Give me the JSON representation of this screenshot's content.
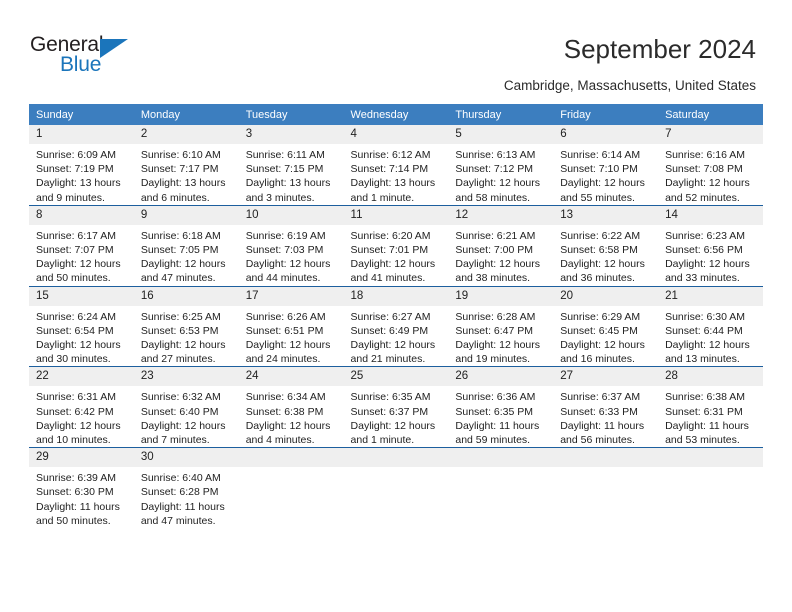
{
  "brand": {
    "name_top": "General",
    "name_bottom": "Blue",
    "accent_color": "#1b75bb"
  },
  "header": {
    "title": "September 2024",
    "subtitle": "Cambridge, Massachusetts, United States"
  },
  "theme": {
    "header_row_bg": "#3c7ebf",
    "row_divider": "#1d5f9e",
    "daynum_bg": "#efefef"
  },
  "weekdays": [
    "Sunday",
    "Monday",
    "Tuesday",
    "Wednesday",
    "Thursday",
    "Friday",
    "Saturday"
  ],
  "weeks": [
    [
      {
        "day": "1",
        "sunrise": "Sunrise: 6:09 AM",
        "sunset": "Sunset: 7:19 PM",
        "daylight1": "Daylight: 13 hours",
        "daylight2": "and 9 minutes."
      },
      {
        "day": "2",
        "sunrise": "Sunrise: 6:10 AM",
        "sunset": "Sunset: 7:17 PM",
        "daylight1": "Daylight: 13 hours",
        "daylight2": "and 6 minutes."
      },
      {
        "day": "3",
        "sunrise": "Sunrise: 6:11 AM",
        "sunset": "Sunset: 7:15 PM",
        "daylight1": "Daylight: 13 hours",
        "daylight2": "and 3 minutes."
      },
      {
        "day": "4",
        "sunrise": "Sunrise: 6:12 AM",
        "sunset": "Sunset: 7:14 PM",
        "daylight1": "Daylight: 13 hours",
        "daylight2": "and 1 minute."
      },
      {
        "day": "5",
        "sunrise": "Sunrise: 6:13 AM",
        "sunset": "Sunset: 7:12 PM",
        "daylight1": "Daylight: 12 hours",
        "daylight2": "and 58 minutes."
      },
      {
        "day": "6",
        "sunrise": "Sunrise: 6:14 AM",
        "sunset": "Sunset: 7:10 PM",
        "daylight1": "Daylight: 12 hours",
        "daylight2": "and 55 minutes."
      },
      {
        "day": "7",
        "sunrise": "Sunrise: 6:16 AM",
        "sunset": "Sunset: 7:08 PM",
        "daylight1": "Daylight: 12 hours",
        "daylight2": "and 52 minutes."
      }
    ],
    [
      {
        "day": "8",
        "sunrise": "Sunrise: 6:17 AM",
        "sunset": "Sunset: 7:07 PM",
        "daylight1": "Daylight: 12 hours",
        "daylight2": "and 50 minutes."
      },
      {
        "day": "9",
        "sunrise": "Sunrise: 6:18 AM",
        "sunset": "Sunset: 7:05 PM",
        "daylight1": "Daylight: 12 hours",
        "daylight2": "and 47 minutes."
      },
      {
        "day": "10",
        "sunrise": "Sunrise: 6:19 AM",
        "sunset": "Sunset: 7:03 PM",
        "daylight1": "Daylight: 12 hours",
        "daylight2": "and 44 minutes."
      },
      {
        "day": "11",
        "sunrise": "Sunrise: 6:20 AM",
        "sunset": "Sunset: 7:01 PM",
        "daylight1": "Daylight: 12 hours",
        "daylight2": "and 41 minutes."
      },
      {
        "day": "12",
        "sunrise": "Sunrise: 6:21 AM",
        "sunset": "Sunset: 7:00 PM",
        "daylight1": "Daylight: 12 hours",
        "daylight2": "and 38 minutes."
      },
      {
        "day": "13",
        "sunrise": "Sunrise: 6:22 AM",
        "sunset": "Sunset: 6:58 PM",
        "daylight1": "Daylight: 12 hours",
        "daylight2": "and 36 minutes."
      },
      {
        "day": "14",
        "sunrise": "Sunrise: 6:23 AM",
        "sunset": "Sunset: 6:56 PM",
        "daylight1": "Daylight: 12 hours",
        "daylight2": "and 33 minutes."
      }
    ],
    [
      {
        "day": "15",
        "sunrise": "Sunrise: 6:24 AM",
        "sunset": "Sunset: 6:54 PM",
        "daylight1": "Daylight: 12 hours",
        "daylight2": "and 30 minutes."
      },
      {
        "day": "16",
        "sunrise": "Sunrise: 6:25 AM",
        "sunset": "Sunset: 6:53 PM",
        "daylight1": "Daylight: 12 hours",
        "daylight2": "and 27 minutes."
      },
      {
        "day": "17",
        "sunrise": "Sunrise: 6:26 AM",
        "sunset": "Sunset: 6:51 PM",
        "daylight1": "Daylight: 12 hours",
        "daylight2": "and 24 minutes."
      },
      {
        "day": "18",
        "sunrise": "Sunrise: 6:27 AM",
        "sunset": "Sunset: 6:49 PM",
        "daylight1": "Daylight: 12 hours",
        "daylight2": "and 21 minutes."
      },
      {
        "day": "19",
        "sunrise": "Sunrise: 6:28 AM",
        "sunset": "Sunset: 6:47 PM",
        "daylight1": "Daylight: 12 hours",
        "daylight2": "and 19 minutes."
      },
      {
        "day": "20",
        "sunrise": "Sunrise: 6:29 AM",
        "sunset": "Sunset: 6:45 PM",
        "daylight1": "Daylight: 12 hours",
        "daylight2": "and 16 minutes."
      },
      {
        "day": "21",
        "sunrise": "Sunrise: 6:30 AM",
        "sunset": "Sunset: 6:44 PM",
        "daylight1": "Daylight: 12 hours",
        "daylight2": "and 13 minutes."
      }
    ],
    [
      {
        "day": "22",
        "sunrise": "Sunrise: 6:31 AM",
        "sunset": "Sunset: 6:42 PM",
        "daylight1": "Daylight: 12 hours",
        "daylight2": "and 10 minutes."
      },
      {
        "day": "23",
        "sunrise": "Sunrise: 6:32 AM",
        "sunset": "Sunset: 6:40 PM",
        "daylight1": "Daylight: 12 hours",
        "daylight2": "and 7 minutes."
      },
      {
        "day": "24",
        "sunrise": "Sunrise: 6:34 AM",
        "sunset": "Sunset: 6:38 PM",
        "daylight1": "Daylight: 12 hours",
        "daylight2": "and 4 minutes."
      },
      {
        "day": "25",
        "sunrise": "Sunrise: 6:35 AM",
        "sunset": "Sunset: 6:37 PM",
        "daylight1": "Daylight: 12 hours",
        "daylight2": "and 1 minute."
      },
      {
        "day": "26",
        "sunrise": "Sunrise: 6:36 AM",
        "sunset": "Sunset: 6:35 PM",
        "daylight1": "Daylight: 11 hours",
        "daylight2": "and 59 minutes."
      },
      {
        "day": "27",
        "sunrise": "Sunrise: 6:37 AM",
        "sunset": "Sunset: 6:33 PM",
        "daylight1": "Daylight: 11 hours",
        "daylight2": "and 56 minutes."
      },
      {
        "day": "28",
        "sunrise": "Sunrise: 6:38 AM",
        "sunset": "Sunset: 6:31 PM",
        "daylight1": "Daylight: 11 hours",
        "daylight2": "and 53 minutes."
      }
    ],
    [
      {
        "day": "29",
        "sunrise": "Sunrise: 6:39 AM",
        "sunset": "Sunset: 6:30 PM",
        "daylight1": "Daylight: 11 hours",
        "daylight2": "and 50 minutes."
      },
      {
        "day": "30",
        "sunrise": "Sunrise: 6:40 AM",
        "sunset": "Sunset: 6:28 PM",
        "daylight1": "Daylight: 11 hours",
        "daylight2": "and 47 minutes."
      },
      {
        "day": "",
        "sunrise": "",
        "sunset": "",
        "daylight1": "",
        "daylight2": ""
      },
      {
        "day": "",
        "sunrise": "",
        "sunset": "",
        "daylight1": "",
        "daylight2": ""
      },
      {
        "day": "",
        "sunrise": "",
        "sunset": "",
        "daylight1": "",
        "daylight2": ""
      },
      {
        "day": "",
        "sunrise": "",
        "sunset": "",
        "daylight1": "",
        "daylight2": ""
      },
      {
        "day": "",
        "sunrise": "",
        "sunset": "",
        "daylight1": "",
        "daylight2": ""
      }
    ]
  ]
}
